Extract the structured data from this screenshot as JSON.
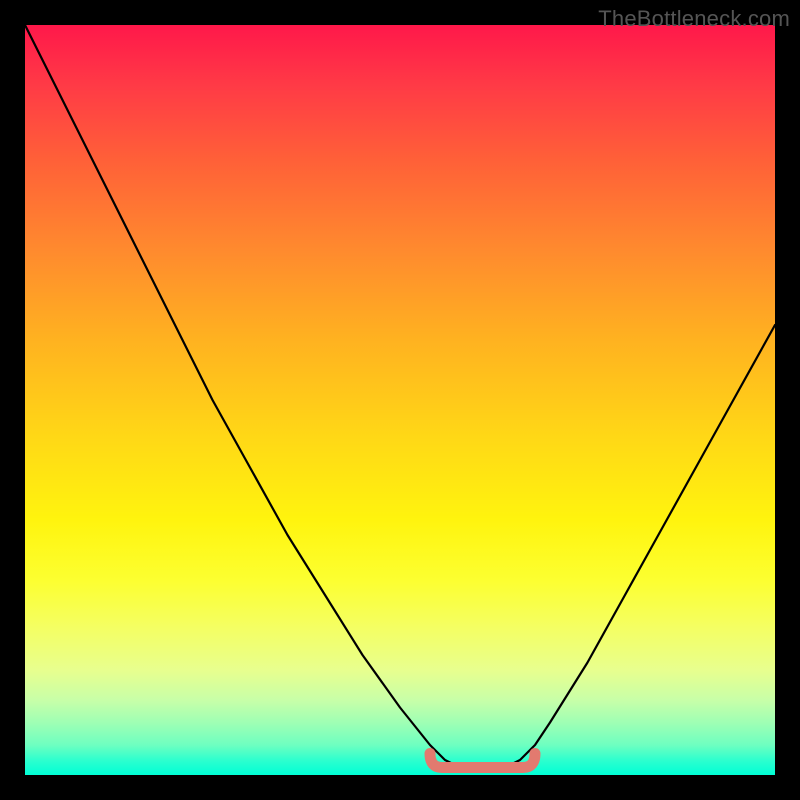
{
  "watermark": "TheBottleneck.com",
  "chart_data": {
    "type": "line",
    "title": "",
    "xlabel": "",
    "ylabel": "",
    "xlim": [
      0,
      100
    ],
    "ylim": [
      0,
      100
    ],
    "grid": false,
    "legend": false,
    "series": [
      {
        "name": "bottleneck-curve",
        "color": "#000000",
        "x": [
          0,
          5,
          10,
          15,
          20,
          25,
          30,
          35,
          40,
          45,
          50,
          54,
          56,
          58,
          60,
          62,
          64,
          66,
          68,
          70,
          75,
          80,
          85,
          90,
          95,
          100
        ],
        "values": [
          100,
          90,
          80,
          70,
          60,
          50,
          41,
          32,
          24,
          16,
          9,
          4,
          2,
          1,
          1,
          1,
          1,
          2,
          4,
          7,
          15,
          24,
          33,
          42,
          51,
          60
        ]
      }
    ],
    "annotations": [
      {
        "name": "optimal-region",
        "color": "#e27a6f",
        "x_range": [
          54,
          68
        ],
        "y": 1
      }
    ],
    "background_gradient": {
      "direction": "vertical",
      "stops": [
        {
          "pos": 0.0,
          "color": "#ff184a"
        },
        {
          "pos": 0.3,
          "color": "#ff8a2e"
        },
        {
          "pos": 0.6,
          "color": "#fff40e"
        },
        {
          "pos": 0.85,
          "color": "#e8ff8e"
        },
        {
          "pos": 1.0,
          "color": "#00ffd6"
        }
      ]
    }
  }
}
